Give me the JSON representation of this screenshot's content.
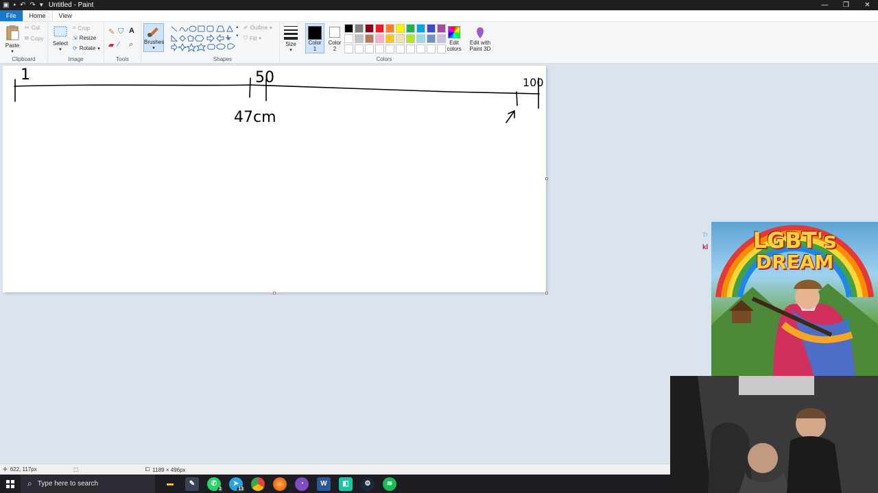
{
  "window": {
    "title": "Untitled - Paint"
  },
  "titlebar": {
    "minimize_icon": "minimize-icon",
    "maximize_icon": "restore-icon",
    "close_icon": "close-icon"
  },
  "menu": {
    "tabs": [
      {
        "label": "File"
      },
      {
        "label": "Home"
      },
      {
        "label": "View"
      }
    ]
  },
  "ribbon": {
    "clipboard": {
      "label": "Clipboard",
      "paste": "Paste",
      "cut": "Cut",
      "copy": "Copy"
    },
    "image": {
      "label": "Image",
      "select": "Select",
      "crop": "Crop",
      "resize": "Resize",
      "rotate": "Rotate"
    },
    "tools": {
      "label": "Tools"
    },
    "brushes": {
      "label": "Brushes"
    },
    "shapes": {
      "label": "Shapes",
      "outline": "Outline",
      "fill": "Fill"
    },
    "size": {
      "label": "Size"
    },
    "colors": {
      "label": "Colors",
      "color1_line1": "Color",
      "color1_line2": "1",
      "color2_line1": "Color",
      "color2_line2": "2",
      "edit_colors_line1": "Edit",
      "edit_colors_line2": "colors",
      "paint3d_line1": "Edit with",
      "paint3d_line2": "Paint 3D",
      "color1_value": "#000000",
      "color2_value": "#ffffff",
      "palette": [
        "#000000",
        "#7f7f7f",
        "#880015",
        "#ed1c24",
        "#ff7f27",
        "#fff200",
        "#22b14c",
        "#00a2e8",
        "#3f48cc",
        "#a349a4",
        "#ffffff",
        "#c3c3c3",
        "#b97a57",
        "#ffaec9",
        "#ffc90e",
        "#efe4b0",
        "#b5e61d",
        "#99d9ea",
        "#7092be",
        "#c8bfe7",
        "#ffffff",
        "#ffffff",
        "#ffffff",
        "#ffffff",
        "#ffffff",
        "#ffffff",
        "#ffffff",
        "#ffffff",
        "#ffffff",
        "#ffffff"
      ]
    }
  },
  "canvas": {
    "drawing_text": {
      "start": "1",
      "middle": "50",
      "end": "100",
      "measure": "47cm"
    }
  },
  "statusbar": {
    "cursor_position": "622, 117px",
    "image_size": "1189 × 496px"
  },
  "overlay": {
    "thumbnail_title_line1": "LGBT's",
    "thumbnail_title_line2": "DREAM",
    "side_text_1": "Tr",
    "side_text_2": "kl"
  },
  "taskbar": {
    "search_placeholder": "Type here to search",
    "whatsapp_badge": "2",
    "chat_badge": "13"
  }
}
